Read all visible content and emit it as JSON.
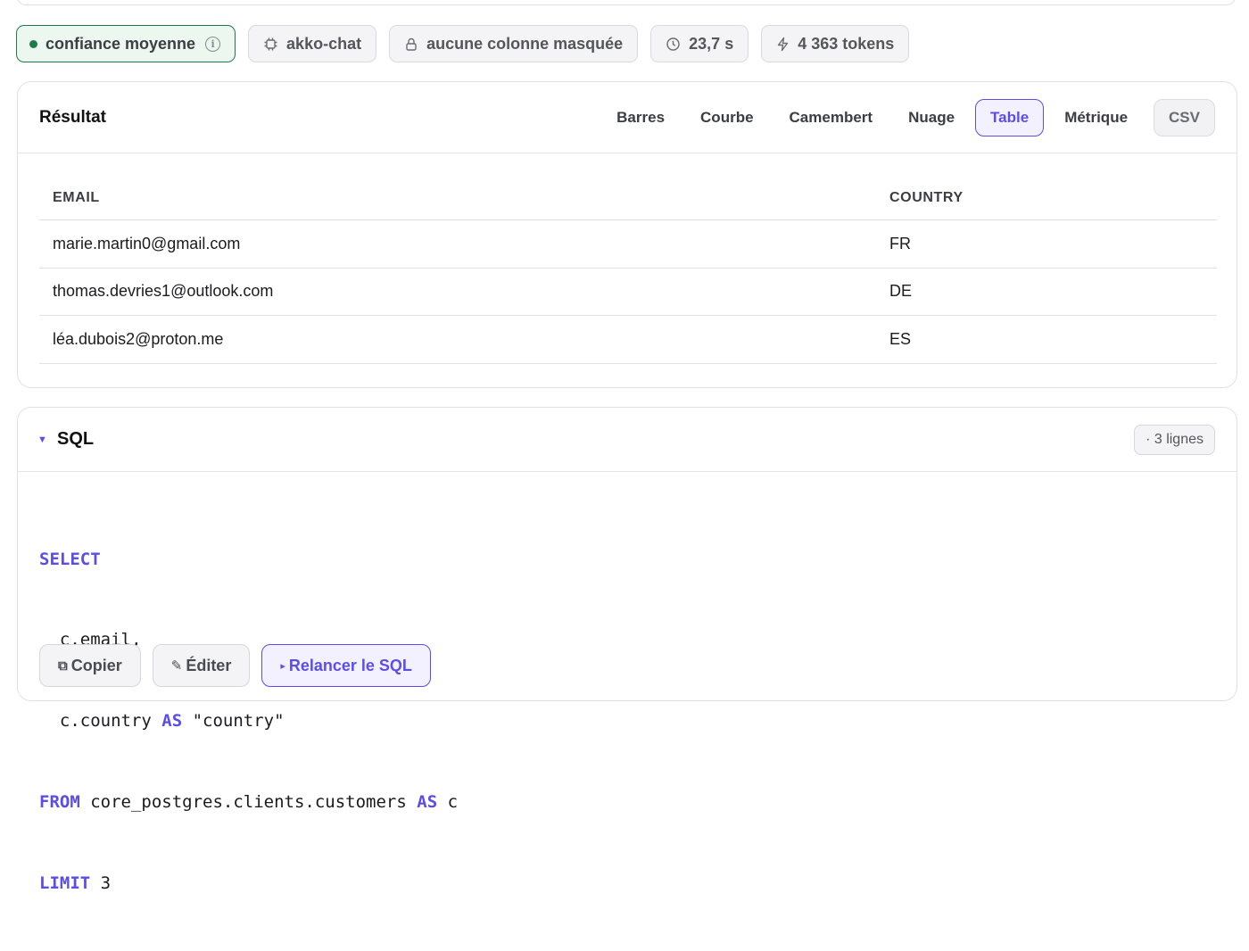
{
  "chips": {
    "confidence": "confiance moyenne",
    "model": "akko-chat",
    "masking": "aucune colonne masquée",
    "duration": "23,7 s",
    "tokens": "4 363 tokens"
  },
  "result": {
    "title": "Résultat",
    "views": [
      "Barres",
      "Courbe",
      "Camembert",
      "Nuage",
      "Table",
      "Métrique"
    ],
    "active_view": "Table",
    "csv_label": "CSV",
    "columns": [
      "EMAIL",
      "COUNTRY"
    ],
    "rows": [
      [
        "marie.martin0@gmail.com",
        "FR"
      ],
      [
        "thomas.devries1@outlook.com",
        "DE"
      ],
      [
        "léa.dubois2@proton.me",
        "ES"
      ]
    ]
  },
  "sql": {
    "title": "SQL",
    "rows_badge": "· 3 lignes",
    "lines": [
      [
        {
          "t": "SELECT",
          "k": true
        }
      ],
      [
        {
          "t": "  c.email,",
          "k": false
        }
      ],
      [
        {
          "t": "  c.country ",
          "k": false
        },
        {
          "t": "AS",
          "k": true
        },
        {
          "t": " \"country\"",
          "k": false
        }
      ],
      [
        {
          "t": "FROM",
          "k": true
        },
        {
          "t": " core_postgres.clients.customers ",
          "k": false
        },
        {
          "t": "AS",
          "k": true
        },
        {
          "t": " c",
          "k": false
        }
      ],
      [
        {
          "t": "LIMIT",
          "k": true
        },
        {
          "t": " 3",
          "k": false
        }
      ]
    ],
    "actions": {
      "copy": "Copier",
      "edit": "Éditer",
      "rerun": "Relancer le SQL"
    }
  },
  "colors": {
    "accent": "#5b4ee8",
    "confidence_green": "#1f7a4c"
  }
}
